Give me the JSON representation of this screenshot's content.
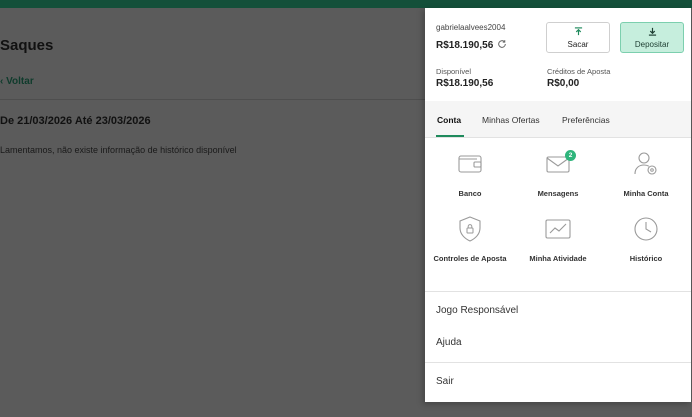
{
  "background": {
    "title": "Saques",
    "back_label": "‹ Voltar",
    "date_range": "De 21/03/2026 Até 23/03/2026",
    "empty_message": "Lamentamos, não existe informação de histórico disponível"
  },
  "account": {
    "username": "gabrielaalvees2004",
    "balance": "R$18.190,56",
    "available_label": "Disponível",
    "available_value": "R$18.190,56",
    "credits_label": "Créditos de Aposta",
    "credits_value": "R$0,00"
  },
  "actions": {
    "withdraw_label": "Sacar",
    "deposit_label": "Depositar"
  },
  "tabs": [
    {
      "label": "Conta",
      "active": true
    },
    {
      "label": "Minhas Ofertas",
      "active": false
    },
    {
      "label": "Preferências",
      "active": false
    }
  ],
  "grid": [
    {
      "label": "Banco",
      "icon": "wallet-icon"
    },
    {
      "label": "Mensagens",
      "icon": "envelope-icon",
      "badge": "2"
    },
    {
      "label": "Minha Conta",
      "icon": "user-settings-icon"
    },
    {
      "label": "Controles de Aposta",
      "icon": "shield-lock-icon"
    },
    {
      "label": "Minha Atividade",
      "icon": "activity-chart-icon"
    },
    {
      "label": "Histórico",
      "icon": "clock-icon"
    }
  ],
  "links": {
    "responsible": "Jogo Responsável",
    "help": "Ajuda",
    "logout": "Sair"
  },
  "colors": {
    "brand_dark": "#14503a",
    "accent": "#1f8a5c",
    "deposit_bg": "#c6eedd",
    "badge": "#2fb57c"
  }
}
